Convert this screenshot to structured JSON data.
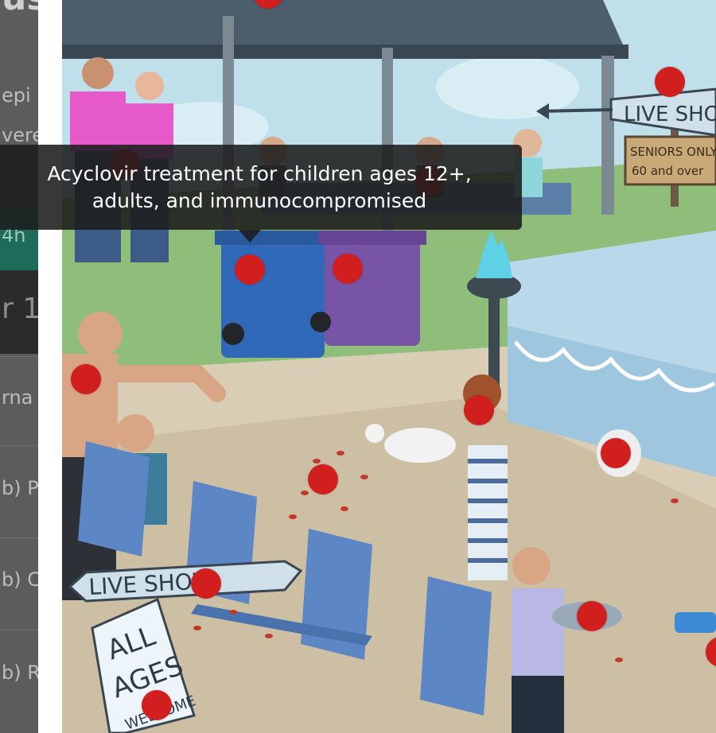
{
  "background_page": {
    "title_fragment": "us",
    "line_fragments": [
      "epi",
      "vere",
      "4h",
      "r 1",
      "rna",
      "b) P",
      "b) C",
      "b) R"
    ]
  },
  "scene": {
    "signs": {
      "live_show_top": "LIVE SHOW",
      "seniors_only_1": "SENIORS ONLY:",
      "seniors_only_2": "60 and over",
      "live_show_bottom": "LIVE SHOW",
      "all_ages_1": "ALL",
      "all_ages_2": "AGES",
      "all_ages_3": "WELCOME"
    }
  },
  "tooltip": {
    "line1": "Acyclovir treatment for children ages 12+,",
    "line2": "adults, and immunocompromised"
  },
  "hotspots": [
    {
      "id": "roof"
    },
    {
      "id": "live-show-sign"
    },
    {
      "id": "staff-pair"
    },
    {
      "id": "seniors-bench"
    },
    {
      "id": "blue-bin"
    },
    {
      "id": "purple-bin"
    },
    {
      "id": "shouting-man"
    },
    {
      "id": "girl-hands-on-head"
    },
    {
      "id": "chicken-right"
    },
    {
      "id": "red-drops-ground"
    },
    {
      "id": "live-show-arrow-sign"
    },
    {
      "id": "boy-with-tray"
    },
    {
      "id": "all-ages-sign"
    },
    {
      "id": "water-gun-edge"
    }
  ],
  "colors": {
    "hotspot": "#d11f1f",
    "tooltip_bg": "#1c1c1c",
    "sky": "#bfe0ea",
    "chair": "#5c86c4"
  }
}
